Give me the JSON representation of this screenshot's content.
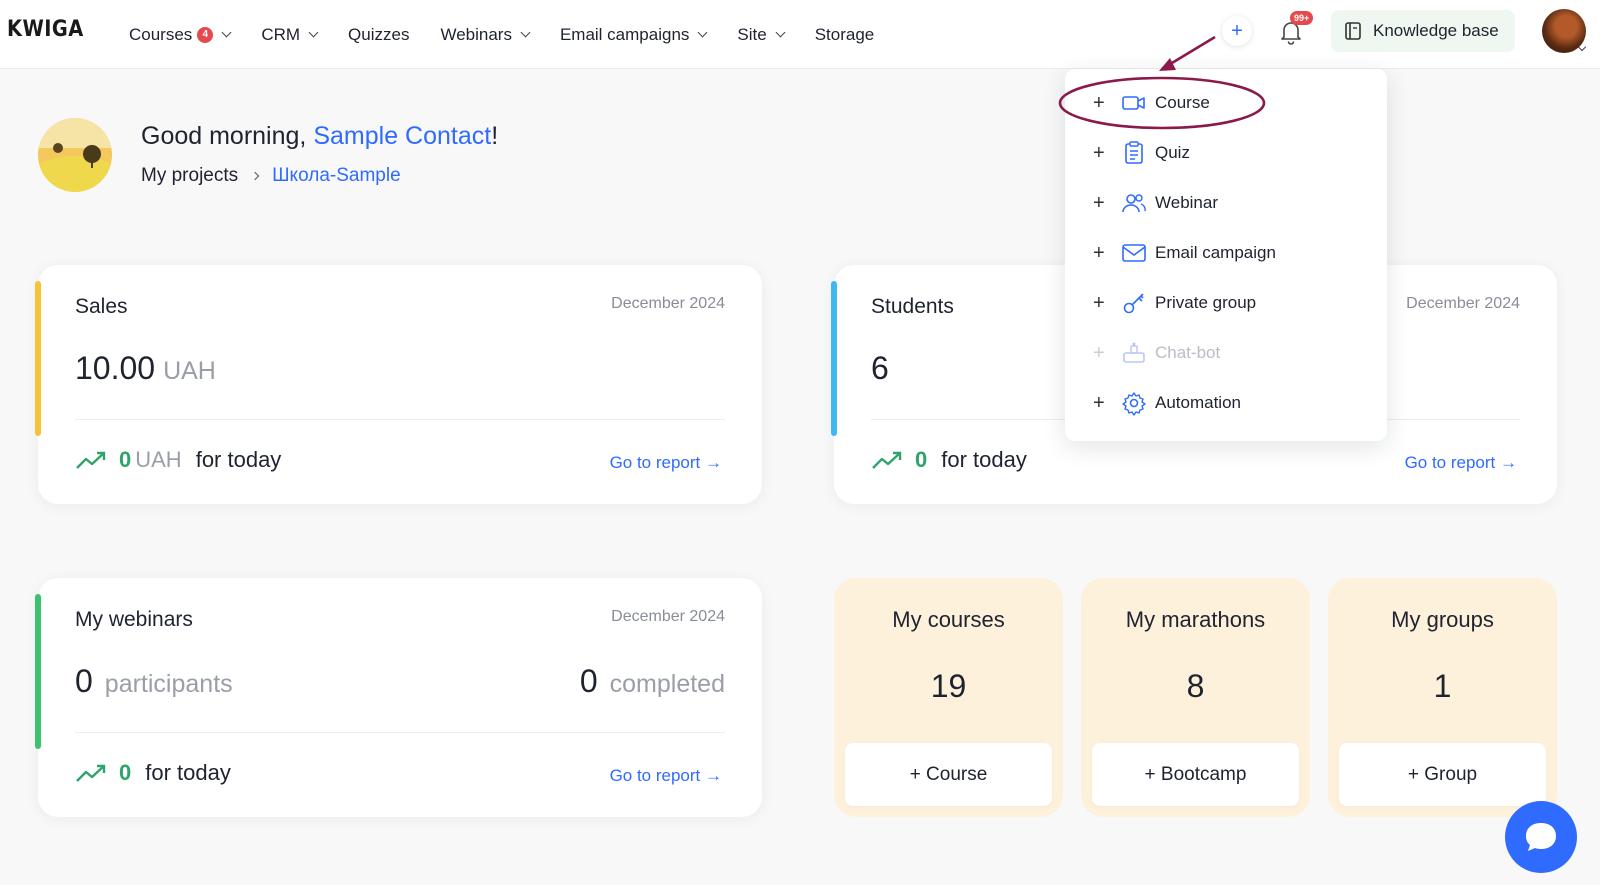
{
  "brand": {
    "logo": "KWIGA"
  },
  "nav": {
    "items": [
      {
        "label": "Courses",
        "badge": "4",
        "dropdown": true
      },
      {
        "label": "CRM",
        "dropdown": true
      },
      {
        "label": "Quizzes",
        "dropdown": false
      },
      {
        "label": "Webinars",
        "dropdown": true
      },
      {
        "label": "Email campaigns",
        "dropdown": true
      },
      {
        "label": "Site",
        "dropdown": true
      },
      {
        "label": "Storage",
        "dropdown": false
      }
    ]
  },
  "header": {
    "plus_label": "+",
    "notifications_badge": "99+",
    "knowledge_base_label": "Knowledge base"
  },
  "greeting": {
    "prefix": "Good morning, ",
    "name": "Sample Contact",
    "suffix": "!",
    "breadcrumb_root": "My projects",
    "breadcrumb_current": "Школа-Sample"
  },
  "sales": {
    "title": "Sales",
    "date": "December 2024",
    "value": "10.00",
    "unit": "UAH",
    "today_value": "0",
    "today_unit": "UAH",
    "today_label": "for today",
    "report_link": "Go to report →",
    "accent_color": "#f7c236"
  },
  "students": {
    "title": "Students",
    "date": "December 2024",
    "value": "6",
    "today_value": "0",
    "today_label": "for today",
    "report_link": "Go to report →",
    "accent_color": "#3fb8f0"
  },
  "webinars": {
    "title": "My webinars",
    "date": "December 2024",
    "participants_value": "0",
    "participants_label": "participants",
    "completed_value": "0",
    "completed_label": "completed",
    "today_value": "0",
    "today_label": "for today",
    "report_link": "Go to report →",
    "accent_color": "#3cc26e"
  },
  "tiles": [
    {
      "title": "My courses",
      "count": "19",
      "button": "+ Course"
    },
    {
      "title": "My marathons",
      "count": "8",
      "button": "+ Bootcamp"
    },
    {
      "title": "My groups",
      "count": "1",
      "button": "+ Group"
    }
  ],
  "create_menu": {
    "items": [
      {
        "label": "Course",
        "icon": "video-icon",
        "disabled": false
      },
      {
        "label": "Quiz",
        "icon": "clipboard-icon",
        "disabled": false
      },
      {
        "label": "Webinar",
        "icon": "users-icon",
        "disabled": false
      },
      {
        "label": "Email campaign",
        "icon": "mail-icon",
        "disabled": false
      },
      {
        "label": "Private group",
        "icon": "key-icon",
        "disabled": false
      },
      {
        "label": "Chat-bot",
        "icon": "bot-icon",
        "disabled": true
      },
      {
        "label": "Automation",
        "icon": "gear-icon",
        "disabled": false
      }
    ]
  },
  "colors": {
    "brand_blue": "#2f6bff",
    "positive_green": "#2ea46a",
    "annotation": "#8b1a4a",
    "tile_bg": "#fdf1dc"
  }
}
